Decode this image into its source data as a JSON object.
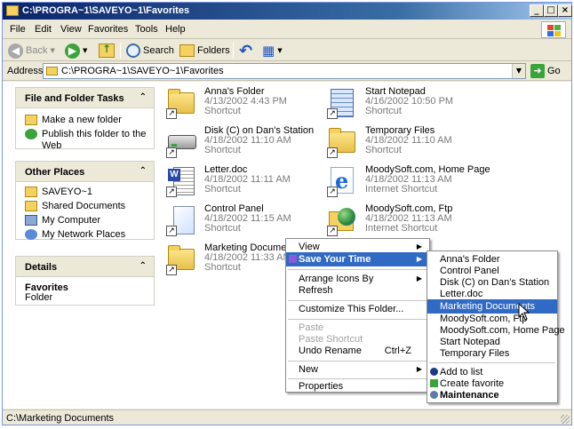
{
  "window": {
    "title": "C:\\PROGRA~1\\SAVEYO~1\\Favorites",
    "controls": {
      "minimize": "_",
      "maximize": "□",
      "close": "×"
    }
  },
  "menubar": [
    "File",
    "Edit",
    "View",
    "Favorites",
    "Tools",
    "Help"
  ],
  "toolbar": {
    "back_label": "Back",
    "search_label": "Search",
    "folders_label": "Folders",
    "view_glyph": "▦"
  },
  "address": {
    "label": "Address",
    "value": "C:\\PROGRA~1\\SAVEYO~1\\Favorites",
    "go_label": "Go"
  },
  "taskpane": {
    "file_tasks": {
      "title": "File and Folder Tasks",
      "items": [
        "Make a new folder",
        "Publish this folder to the Web"
      ]
    },
    "other_places": {
      "title": "Other Places",
      "items": [
        "SAVEYO~1",
        "Shared Documents",
        "My Computer",
        "My Network Places"
      ]
    },
    "details": {
      "title": "Details",
      "name": "Favorites",
      "type": "Folder"
    },
    "chevron": "⌃"
  },
  "files": [
    {
      "name": "Anna's Folder",
      "date": "4/13/2002 4:43 PM",
      "type": "Shortcut",
      "icon": "folder-icon"
    },
    {
      "name": "Start Notepad",
      "date": "4/16/2002 10:50 PM",
      "type": "Shortcut",
      "icon": "notepad-icon"
    },
    {
      "name": "Disk (C) on Dan's Station",
      "date": "4/18/2002 11:10 AM",
      "type": "Shortcut",
      "icon": "disk-drive-icon"
    },
    {
      "name": "Temporary Files",
      "date": "4/18/2002 11:10 AM",
      "type": "Shortcut",
      "icon": "folder-icon"
    },
    {
      "name": "Letter.doc",
      "date": "4/18/2002 11:11 AM",
      "type": "Shortcut",
      "icon": "word-document-icon"
    },
    {
      "name": "MoodySoft.com, Home Page",
      "date": "4/18/2002 11:13 AM",
      "type": "Internet Shortcut",
      "icon": "internet-explorer-icon"
    },
    {
      "name": "Control Panel",
      "date": "4/18/2002 11:15 AM",
      "type": "Shortcut",
      "icon": "document-icon"
    },
    {
      "name": "MoodySoft.com, Ftp",
      "date": "4/18/2002 11:13 AM",
      "type": "Internet Shortcut",
      "icon": "ftp-globe-icon"
    },
    {
      "name": "Marketing Documents",
      "date": "4/18/2002 11:33 AM",
      "type": "Shortcut",
      "icon": "folder-icon"
    }
  ],
  "context_menu": {
    "items": [
      {
        "label": "View",
        "submenu": true
      },
      {
        "label": "Save Your Time",
        "submenu": true,
        "highlighted": true
      },
      {
        "label": "Arrange Icons By",
        "submenu": true
      },
      {
        "label": "Refresh"
      },
      {
        "label": "Customize This Folder..."
      },
      {
        "label": "Paste",
        "disabled": true
      },
      {
        "label": "Paste Shortcut",
        "disabled": true
      },
      {
        "label": "Undo Rename",
        "accelerator": "Ctrl+Z"
      },
      {
        "label": "New",
        "submenu": true
      },
      {
        "label": "Properties"
      }
    ],
    "arrow": "▶"
  },
  "submenu": {
    "items": [
      "Anna's Folder",
      "Control Panel",
      "Disk (C) on Dan's Station",
      "Letter.doc",
      "Marketing Documents",
      "MoodySoft.com, Ftp",
      "MoodySoft.com, Home Page",
      "Start Notepad",
      "Temporary Files"
    ],
    "highlighted_index": 4,
    "actions": [
      "Add to list",
      "Create favorite",
      "Maintenance"
    ]
  },
  "statusbar": {
    "text": "C:\\Marketing Documents"
  },
  "shortcut_glyph": "↗",
  "go_glyph": "➜",
  "dropdown_glyph": "▼"
}
